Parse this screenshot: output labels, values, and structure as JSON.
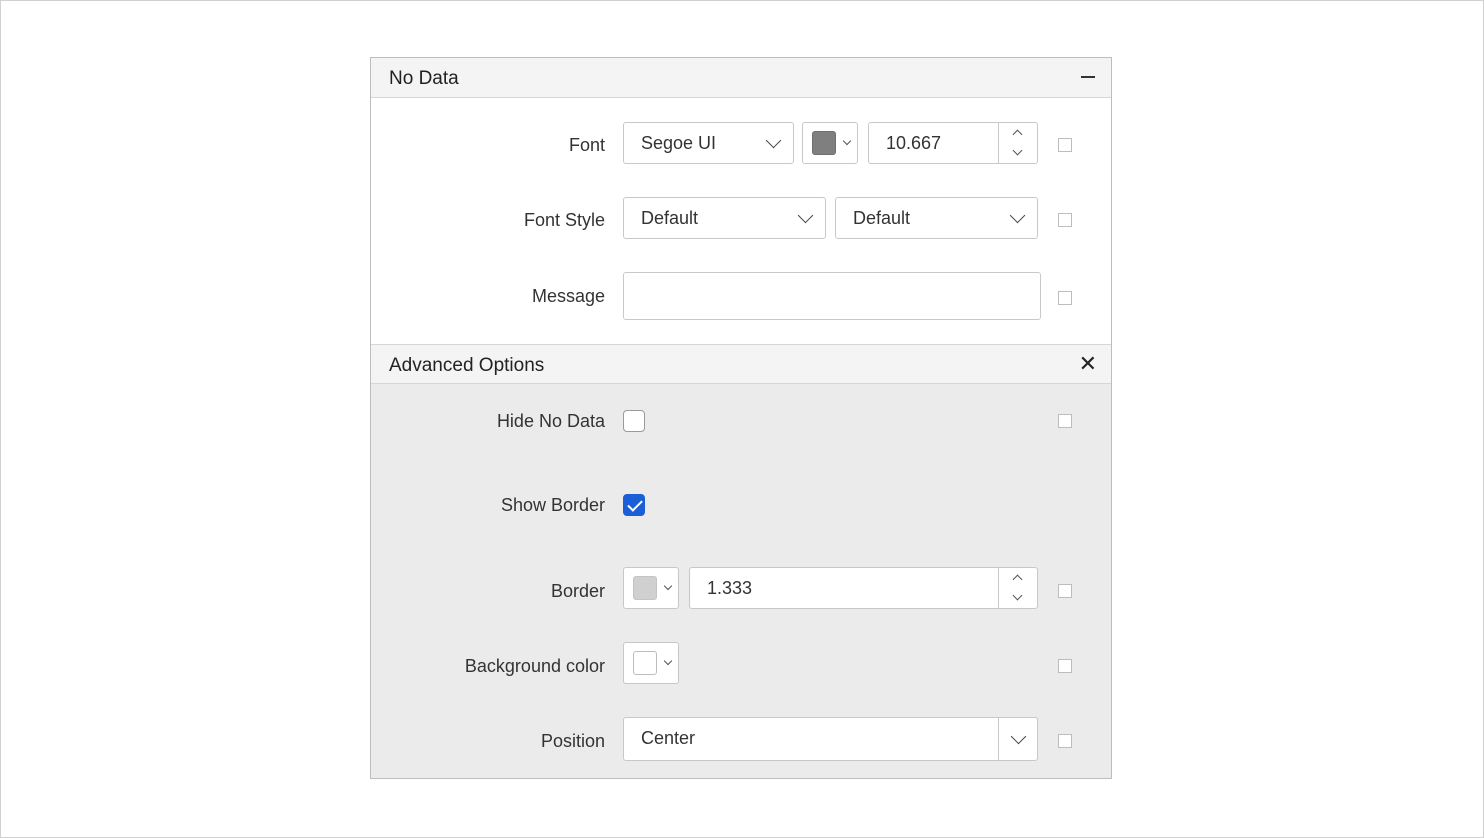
{
  "no_data": {
    "title": "No Data",
    "font": {
      "label": "Font",
      "family": "Segoe UI",
      "color": "#7f7f7f",
      "size": "10.667"
    },
    "font_style": {
      "label": "Font Style",
      "style": "Default",
      "weight": "Default"
    },
    "message": {
      "label": "Message",
      "value": ""
    }
  },
  "advanced": {
    "title": "Advanced Options",
    "hide_no_data": {
      "label": "Hide No Data",
      "checked": false
    },
    "show_border": {
      "label": "Show Border",
      "checked": true
    },
    "border": {
      "label": "Border",
      "color": "#d0d0d0",
      "width": "1.333"
    },
    "background_color": {
      "label": "Background color",
      "color": "#ffffff"
    },
    "position": {
      "label": "Position",
      "value": "Center"
    }
  },
  "colors": {
    "accent": "#1a5fd6",
    "panel_border": "#bdbdbd",
    "advanced_background": "#ebebeb"
  }
}
